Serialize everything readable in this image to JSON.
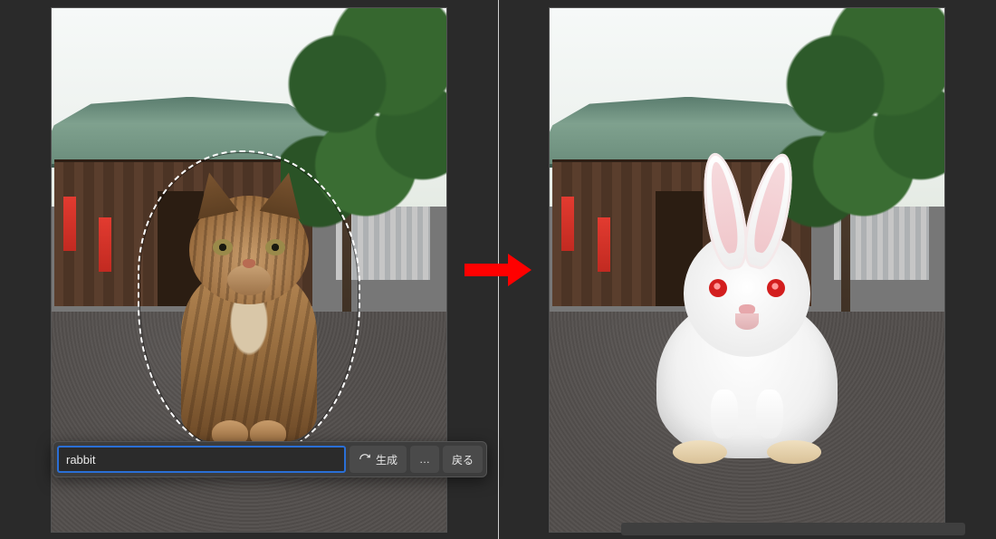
{
  "source_image": {
    "subject": "cat",
    "selection_active": true,
    "selection_shape": "freehand-lasso"
  },
  "result_image": {
    "subject": "rabbit"
  },
  "prompt_bar": {
    "input_value": "rabbit",
    "placeholder": "",
    "generate_label": "生成",
    "back_label": "戻る",
    "more_label": "…"
  },
  "arrow": {
    "direction": "right",
    "color": "#ff0000"
  }
}
